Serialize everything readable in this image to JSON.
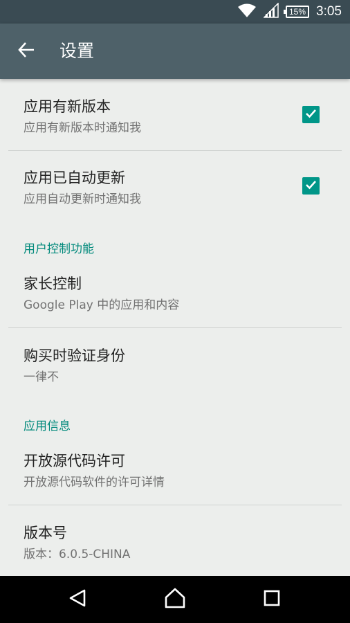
{
  "status_bar": {
    "battery": "15%",
    "time": "3:05"
  },
  "app_bar": {
    "title": "设置"
  },
  "preferences": [
    {
      "title": "应用有新版本",
      "summary": "应用有新版本时通知我",
      "checked": true
    },
    {
      "title": "应用已自动更新",
      "summary": "应用自动更新时通知我",
      "checked": true
    }
  ],
  "sections": [
    {
      "header": "用户控制功能",
      "items": [
        {
          "title": "家长控制",
          "summary": "Google Play 中的应用和内容"
        },
        {
          "title": "购买时验证身份",
          "summary": "一律不"
        }
      ]
    },
    {
      "header": "应用信息",
      "items": [
        {
          "title": "开放源代码许可",
          "summary": "开放源代码软件的许可详情"
        },
        {
          "title": "版本号",
          "summary": "版本：6.0.5-CHINA"
        }
      ]
    }
  ],
  "colors": {
    "status_bar": "#3a4b53",
    "app_bar": "#4e6169",
    "accent": "#009688",
    "section_header": "#00897b",
    "background": "#eceeec"
  },
  "icons": {
    "back": "arrow-back-icon",
    "wifi": "wifi-icon",
    "signal": "signal-icon",
    "battery": "battery-icon",
    "checkbox": "check-icon",
    "nav_back": "triangle-back-icon",
    "nav_home": "home-icon",
    "nav_recents": "square-recents-icon"
  }
}
